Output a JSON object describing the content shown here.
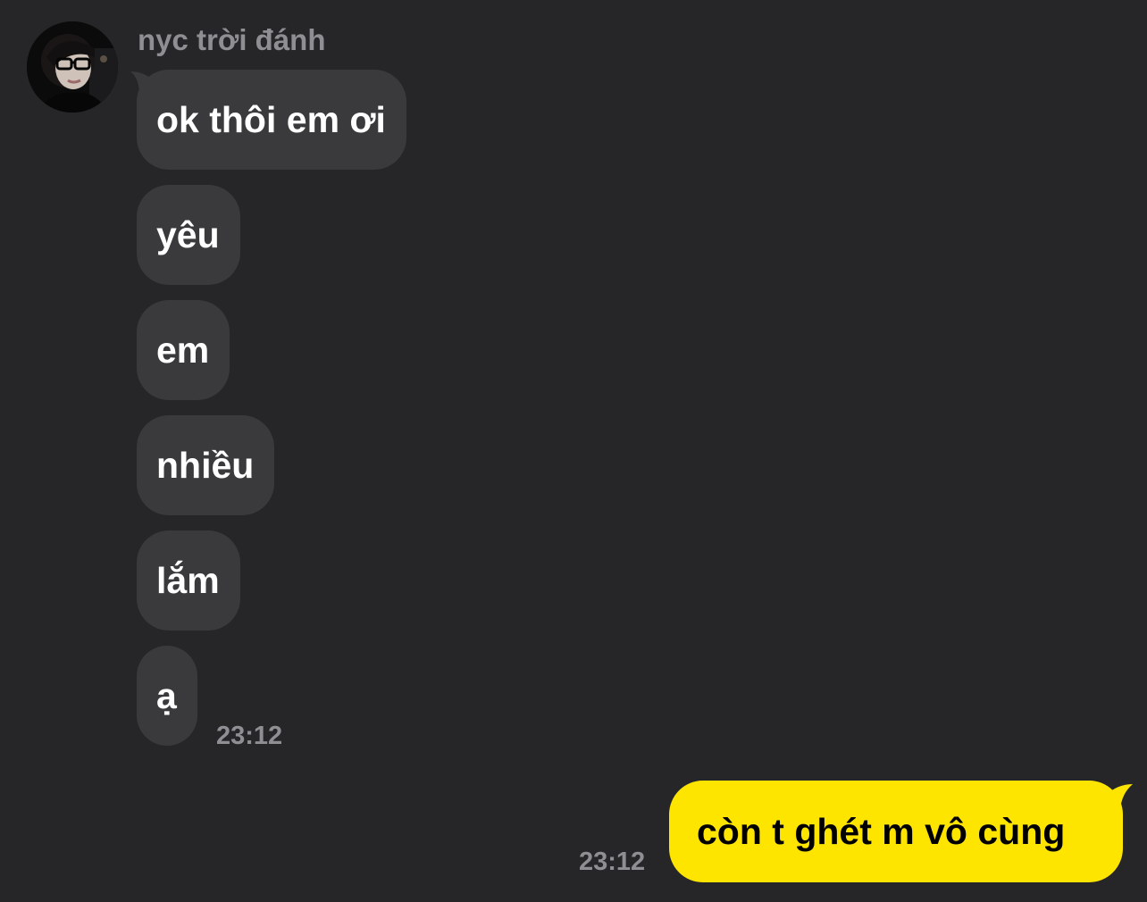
{
  "chat": {
    "sender_name": "nyc trời đánh",
    "incoming": [
      {
        "text": "ok thôi em ơi"
      },
      {
        "text": "yêu"
      },
      {
        "text": "em"
      },
      {
        "text": "nhiều"
      },
      {
        "text": "lắm"
      },
      {
        "text": "ạ"
      }
    ],
    "incoming_time": "23:12",
    "outgoing": {
      "text": "còn t ghét m vô cùng"
    },
    "outgoing_time": "23:12"
  },
  "colors": {
    "background": "#262628",
    "incoming_bubble": "#3a3a3c",
    "outgoing_bubble": "#fee500",
    "meta_text": "#8e8e93"
  },
  "icons": {
    "avatar": "profile-photo"
  }
}
